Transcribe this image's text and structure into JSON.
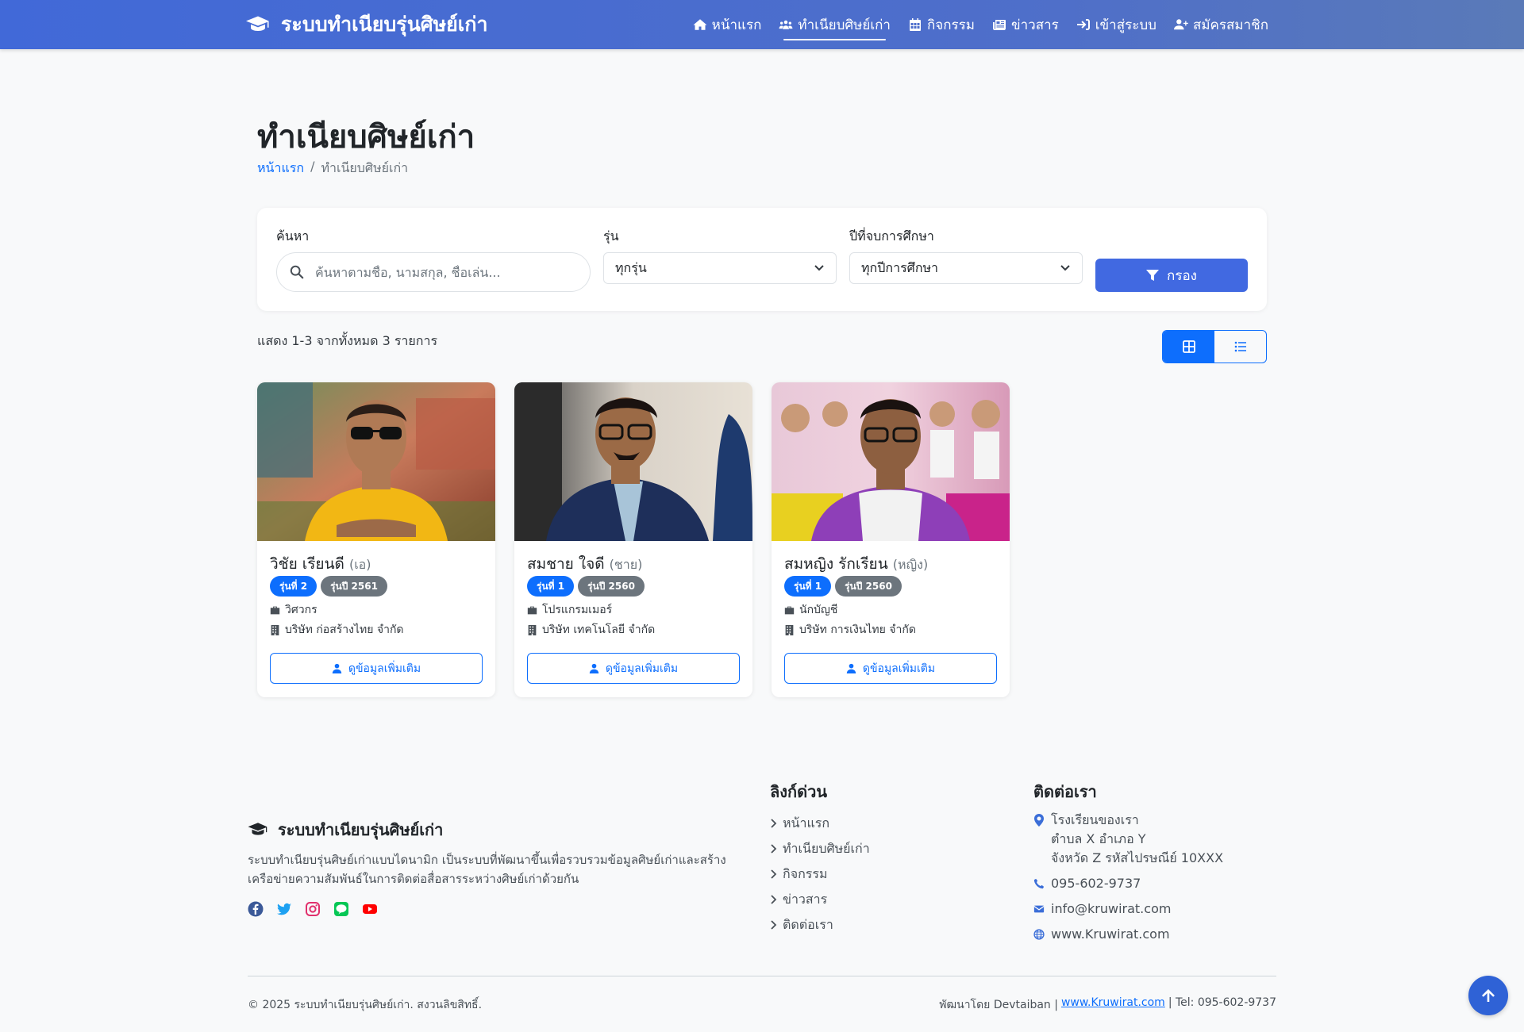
{
  "navbar": {
    "brand": "ระบบทำเนียบรุ่นศิษย์เก่า",
    "links": [
      {
        "label": "หน้าแรก",
        "icon": "home-icon",
        "active": false
      },
      {
        "label": "ทำเนียบศิษย์เก่า",
        "icon": "users-icon",
        "active": true
      },
      {
        "label": "กิจกรรม",
        "icon": "calendar-icon",
        "active": false
      },
      {
        "label": "ข่าวสาร",
        "icon": "newspaper-icon",
        "active": false
      },
      {
        "label": "เข้าสู่ระบบ",
        "icon": "sign-in-icon",
        "active": false
      },
      {
        "label": "สมัครสมาชิก",
        "icon": "user-plus-icon",
        "active": false
      }
    ]
  },
  "page": {
    "title": "ทำเนียบศิษย์เก่า",
    "breadcrumb": {
      "home": "หน้าแรก",
      "separator": "/",
      "current": "ทำเนียบศิษย์เก่า"
    }
  },
  "filters": {
    "search_label": "ค้นหา",
    "search_placeholder": "ค้นหาตามชื่อ, นามสกุล, ชื่อเล่น...",
    "generation_label": "รุ่น",
    "generation_value": "ทุกรุ่น",
    "year_label": "ปีที่จบการศึกษา",
    "year_value": "ทุกปีการศึกษา",
    "filter_button": "กรอง"
  },
  "results": {
    "count_text": "แสดง 1-3 จากทั้งหมด 3 รายการ",
    "view_mode": "grid"
  },
  "alumni": [
    {
      "name": "วิชัย เรียนดี",
      "nickname": "(เอ)",
      "badge_generation": "รุ่นที่ 2",
      "badge_year": "รุ่นปี 2561",
      "occupation": "วิศวกร",
      "company": "บริษัท ก่อสร้างไทย จำกัด",
      "button": "ดูข้อมูลเพิ่มเติม",
      "shirt_color": "#f2b714"
    },
    {
      "name": "สมชาย ใจดี",
      "nickname": "(ชาย)",
      "badge_generation": "รุ่นที่ 1",
      "badge_year": "รุ่นปี 2560",
      "occupation": "โปรแกรมเมอร์",
      "company": "บริษัท เทคโนโลยี จำกัด",
      "button": "ดูข้อมูลเพิ่มเติม",
      "shirt_color": "#1e2f5a"
    },
    {
      "name": "สมหญิง รักเรียน",
      "nickname": "(หญิง)",
      "badge_generation": "รุ่นที่ 1",
      "badge_year": "รุ่นปี 2560",
      "occupation": "นักบัญชี",
      "company": "บริษัท การเงินไทย จำกัด",
      "button": "ดูข้อมูลเพิ่มเติม",
      "shirt_color": "#8e3fb8"
    }
  ],
  "footer": {
    "brand": "ระบบทำเนียบรุ่นศิษย์เก่า",
    "description": "ระบบทำเนียบรุ่นศิษย์เก่าแบบไดนามิก เป็นระบบที่พัฒนาขึ้นเพื่อรวบรวมข้อมูลศิษย์เก่าและสร้างเครือข่ายความสัมพันธ์ในการติดต่อสื่อสารระหว่างศิษย์เก่าด้วยกัน",
    "socials": [
      "facebook-icon",
      "twitter-icon",
      "instagram-icon",
      "line-icon",
      "youtube-icon"
    ],
    "quick_links_heading": "ลิงก์ด่วน",
    "quick_links": [
      "หน้าแรก",
      "ทำเนียบศิษย์เก่า",
      "กิจกรรม",
      "ข่าวสาร",
      "ติดต่อเรา"
    ],
    "contact_heading": "ติดต่อเรา",
    "address": [
      "โรงเรียนของเรา",
      "ตำบล X อำเภอ Y",
      "จังหวัด Z รหัสไปรษณีย์ 10XXX"
    ],
    "phone": "095-602-9737",
    "email": "info@kruwirat.com",
    "website": "www.Kruwirat.com",
    "copyright": "© 2025 ระบบทำเนียบรุ่นศิษย์เก่า. สงวนลิขสิทธิ์.",
    "credit_prefix": "พัฒนาโดย Devtaiban |",
    "credit_link": "www.Kruwirat.com",
    "credit_suffix": "| Tel: 095-602-9737"
  },
  "colors": {
    "primary": "#0d6efd",
    "nav_gradient_start": "#4169d8",
    "filter_button": "#4169e1",
    "badge_gray": "#6c757d"
  }
}
